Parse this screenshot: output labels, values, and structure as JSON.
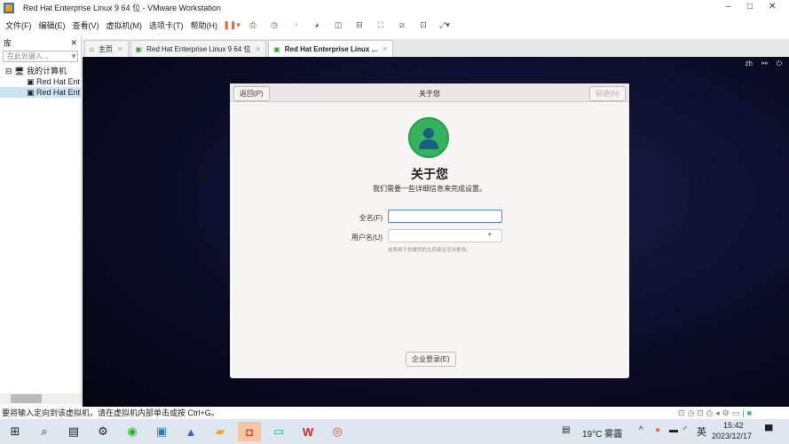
{
  "window": {
    "title": "Red Hat Enterprise Linux 9 64 位 - VMware Workstation",
    "min": "–",
    "max": "□",
    "close": "✕"
  },
  "menu": [
    "文件(F)",
    "编辑(E)",
    "查看(V)",
    "虚拟机(M)",
    "选项卡(T)",
    "帮助(H)"
  ],
  "library": {
    "title": "库",
    "close": "✕",
    "search_placeholder": "在此处键入...",
    "tree": [
      "我的计算机",
      "Red Hat Ent",
      "Red Hat Ent"
    ]
  },
  "tabs": [
    {
      "label": "主页"
    },
    {
      "label": "Red Hat Enterprise Linux 9 64 位"
    },
    {
      "label": "Red Hat Enterprise Linux ..."
    }
  ],
  "vm_topbar": {
    "lang": "zh"
  },
  "dialog": {
    "back": "返回(P)",
    "title": "关于您",
    "next": "前进(N)",
    "heading": "关于您",
    "subtitle": "我们需要一些详细信息来完成设置。",
    "fullname_label": "全名(F)",
    "fullname_value": "",
    "username_label": "用户名(U)",
    "username_value": "",
    "hint": "这将用于创建您的主目录且无法更改。",
    "enterprise": "企业登录(E)"
  },
  "statusbar": "要将输入定向到该虚拟机，请在虚拟机内部单击或按 Ctrl+G。",
  "taskbar": {
    "weather": "19°C 雾霾",
    "ime": "英",
    "time": "15:42",
    "date": "2023/12/17"
  }
}
